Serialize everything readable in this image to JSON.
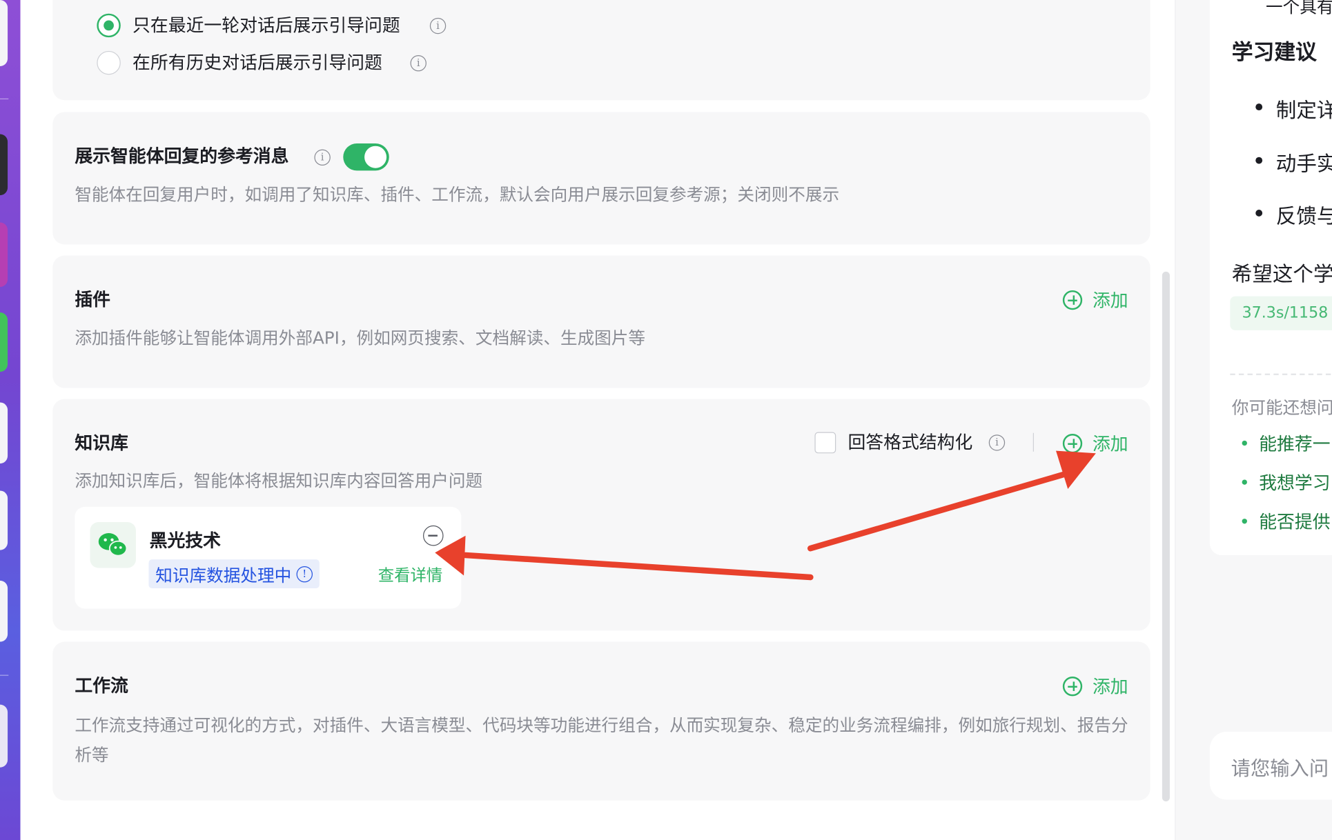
{
  "guide_questions": {
    "option_recent": "只在最近一轮对话后展示引导问题",
    "option_all": "在所有历史对话后展示引导问题",
    "selected": "option_recent"
  },
  "reference_section": {
    "title": "展示智能体回复的参考消息",
    "enabled": true,
    "description": "智能体在回复用户时，如调用了知识库、插件、工作流，默认会向用户展示回复参考源；关闭则不展示"
  },
  "plugin_section": {
    "title": "插件",
    "description": "添加插件能够让智能体调用外部API，例如网页搜索、文档解读、生成图片等",
    "add_label": "添加"
  },
  "knowledge_section": {
    "title": "知识库",
    "description": "添加知识库后，智能体将根据知识库内容回答用户问题",
    "structured_label": "回答格式结构化",
    "structured_checked": false,
    "add_label": "添加",
    "item": {
      "name": "黑光技术",
      "status": "知识库数据处理中",
      "details_label": "查看详情",
      "icon": "wechat-icon"
    }
  },
  "workflow_section": {
    "title": "工作流",
    "description": "工作流支持通过可视化的方式，对插件、大语言模型、代码块等功能进行组合，从而实现复杂、稳定的业务流程编排，例如旅行规划、报告分析等",
    "add_label": "添加"
  },
  "chat_preview": {
    "top_fragment": "一个具有",
    "heading": "学习建议",
    "bullets": [
      "制定详",
      "动手实",
      "反馈与"
    ],
    "closing": "希望这个学",
    "stats_badge": "37.3s/1158",
    "suggest_title": "你可能还想问",
    "suggestions": [
      "能推荐一",
      "我想学习",
      "能否提供"
    ],
    "input_placeholder": "请您输入问"
  },
  "colors": {
    "accent": "#2fb467",
    "annotation_arrow": "#e8412c",
    "status_blue": "#2453e0",
    "card_bg": "#f7f7f8"
  }
}
